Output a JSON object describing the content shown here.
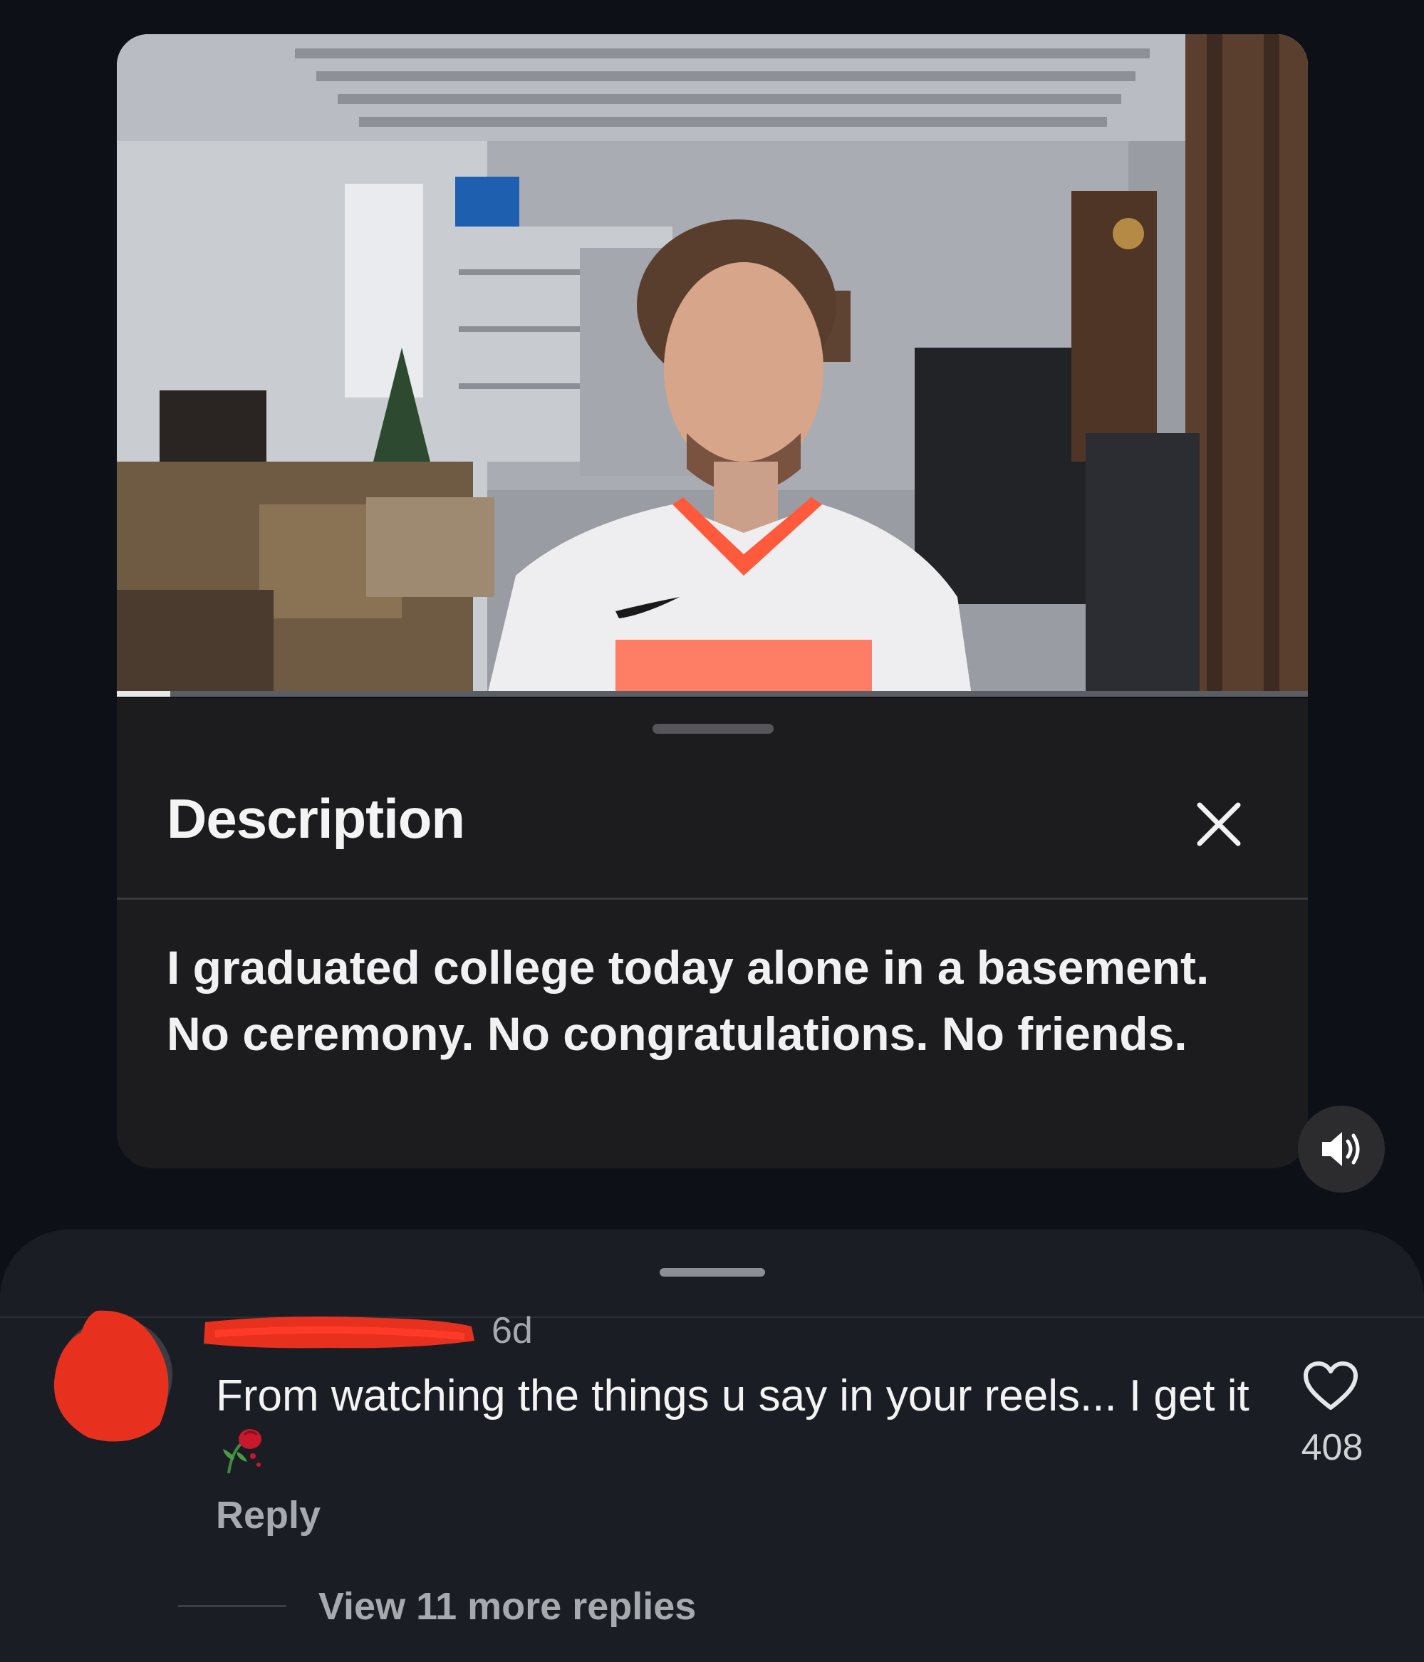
{
  "description_sheet": {
    "title": "Description",
    "body": "I graduated college today alone in a basement. No ceremony. No congratulations. No friends."
  },
  "video": {
    "progress_fraction": 0.045
  },
  "comment": {
    "time": "6d",
    "text": "From watching the things u say in your reels... I get it",
    "emoji": "wilted-rose",
    "reply_label": "Reply",
    "likes": "408",
    "view_more_label": "View 11 more replies"
  },
  "icons": {
    "close": "close-icon",
    "volume": "volume-icon",
    "like": "heart-icon",
    "rose": "wilted-rose-icon"
  },
  "colors": {
    "redaction": "#e8301f",
    "sheet_bg": "#1c1b1e",
    "comments_bg": "#1a1e24"
  }
}
